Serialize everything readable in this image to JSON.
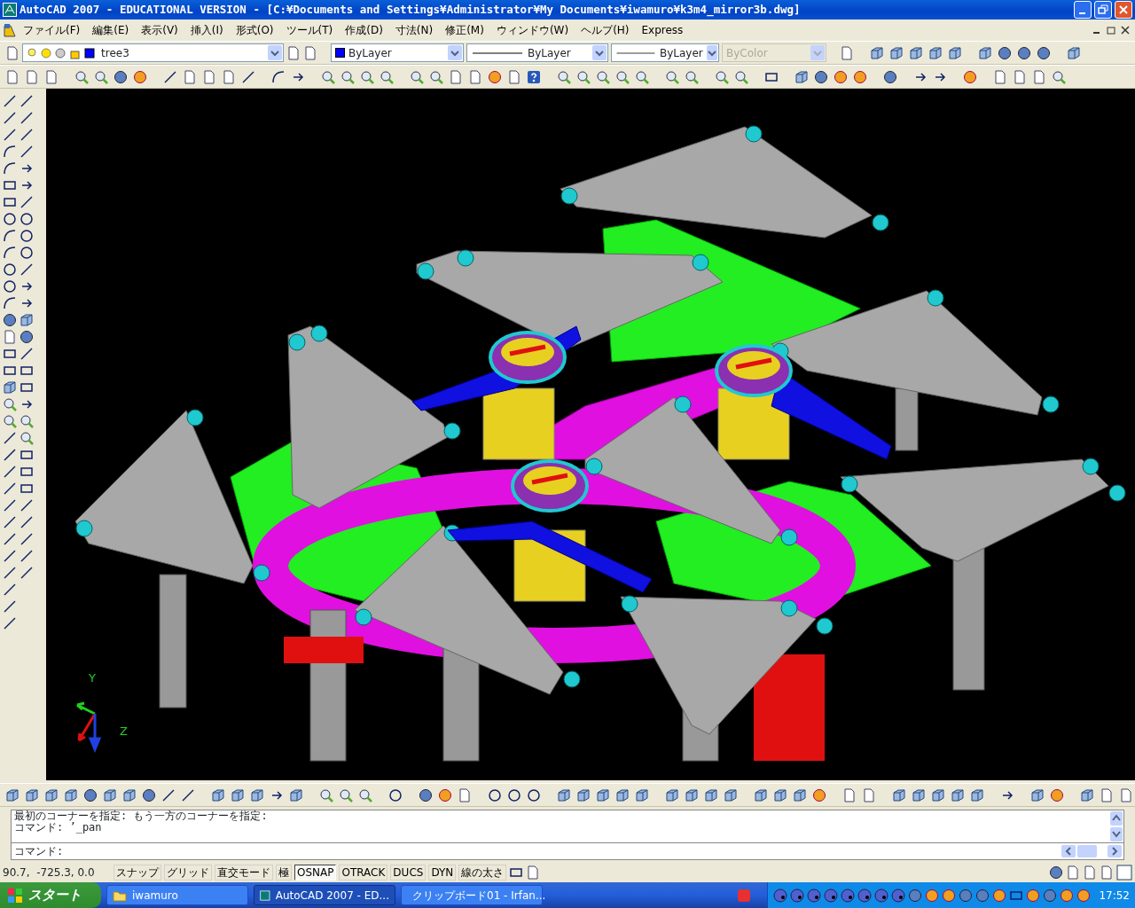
{
  "window": {
    "title": "AutoCAD 2007 - EDUCATIONAL VERSION - [C:¥Documents and Settings¥Administrator¥My Documents¥iwamuro¥k3m4_mirror3b.dwg]"
  },
  "menu": [
    "ファイル(F)",
    "編集(E)",
    "表示(V)",
    "挿入(I)",
    "形式(O)",
    "ツール(T)",
    "作成(D)",
    "寸法(N)",
    "修正(M)",
    "ウィンドウ(W)",
    "ヘルプ(H)",
    "Express"
  ],
  "properties_toolbar": {
    "layer": "tree3",
    "color_setting": "ByLayer",
    "linetype": "ByLayer",
    "lineweight": "ByLayer",
    "plot_style": {
      "value": "ByColor",
      "disabled": true
    }
  },
  "viewport": {
    "ucs_labels": [
      "Y",
      "Z"
    ]
  },
  "command": {
    "history": [
      "最初のコーナーを指定: もう一方のコーナーを指定:",
      "コマンド: ’_pan"
    ],
    "prompt": "コマンド:"
  },
  "status_bar": {
    "coordinates": "90.7,  -725.3, 0.0",
    "toggles": [
      {
        "label": "スナップ",
        "on": false
      },
      {
        "label": "グリッド",
        "on": false
      },
      {
        "label": "直交モード",
        "on": false
      },
      {
        "label": "極",
        "on": false
      },
      {
        "label": "OSNAP",
        "on": true
      },
      {
        "label": "OTRACK",
        "on": false
      },
      {
        "label": "DUCS",
        "on": false
      },
      {
        "label": "DYN",
        "on": false
      },
      {
        "label": "線の太さ",
        "on": false
      }
    ]
  },
  "taskbar": {
    "start": "スタート",
    "tasks": [
      {
        "label": "iwamuro",
        "selected": false
      },
      {
        "label": "AutoCAD 2007 - ED...",
        "selected": true
      },
      {
        "label": "クリップボード01 - Irfan...",
        "selected": false
      }
    ],
    "clock": "17:52"
  }
}
